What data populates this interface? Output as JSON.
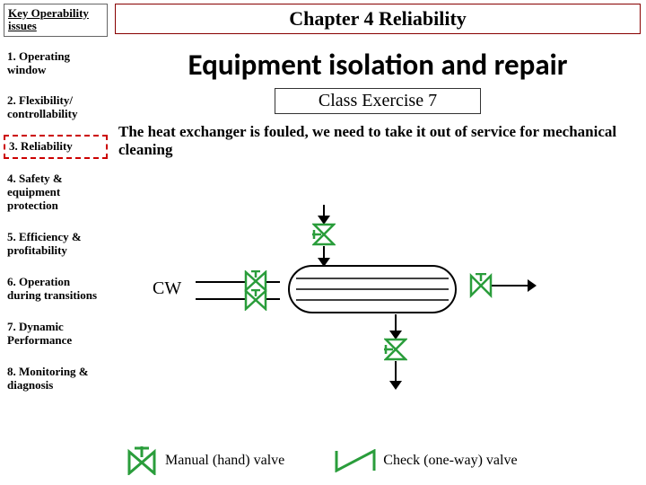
{
  "sidebar": {
    "header": "Key Operability issues",
    "items": [
      {
        "label": "1. Operating window",
        "highlighted": false
      },
      {
        "label": "2. Flexibility/ controllability",
        "highlighted": false
      },
      {
        "label": "3. Reliability",
        "highlighted": true
      },
      {
        "label": "4. Safety & equipment protection",
        "highlighted": false
      },
      {
        "label": "5. Efficiency & profitability",
        "highlighted": false
      },
      {
        "label": "6. Operation during transitions",
        "highlighted": false
      },
      {
        "label": "7. Dynamic Performance",
        "highlighted": false
      },
      {
        "label": "8. Monitoring & diagnosis",
        "highlighted": false
      }
    ]
  },
  "content": {
    "chapter_title": "Chapter 4 Reliability",
    "main_title": "Equipment isolation and repair",
    "subtitle": "Class Exercise 7",
    "body_text": "The heat exchanger is fouled, we need to take it out of service for mechanical cleaning",
    "cw_label": "CW"
  },
  "legend": {
    "manual_valve": "Manual (hand) valve",
    "check_valve": "Check (one-way) valve"
  },
  "icons": {
    "valve_color": "#2a9d3b",
    "arrow_color": "#000"
  }
}
